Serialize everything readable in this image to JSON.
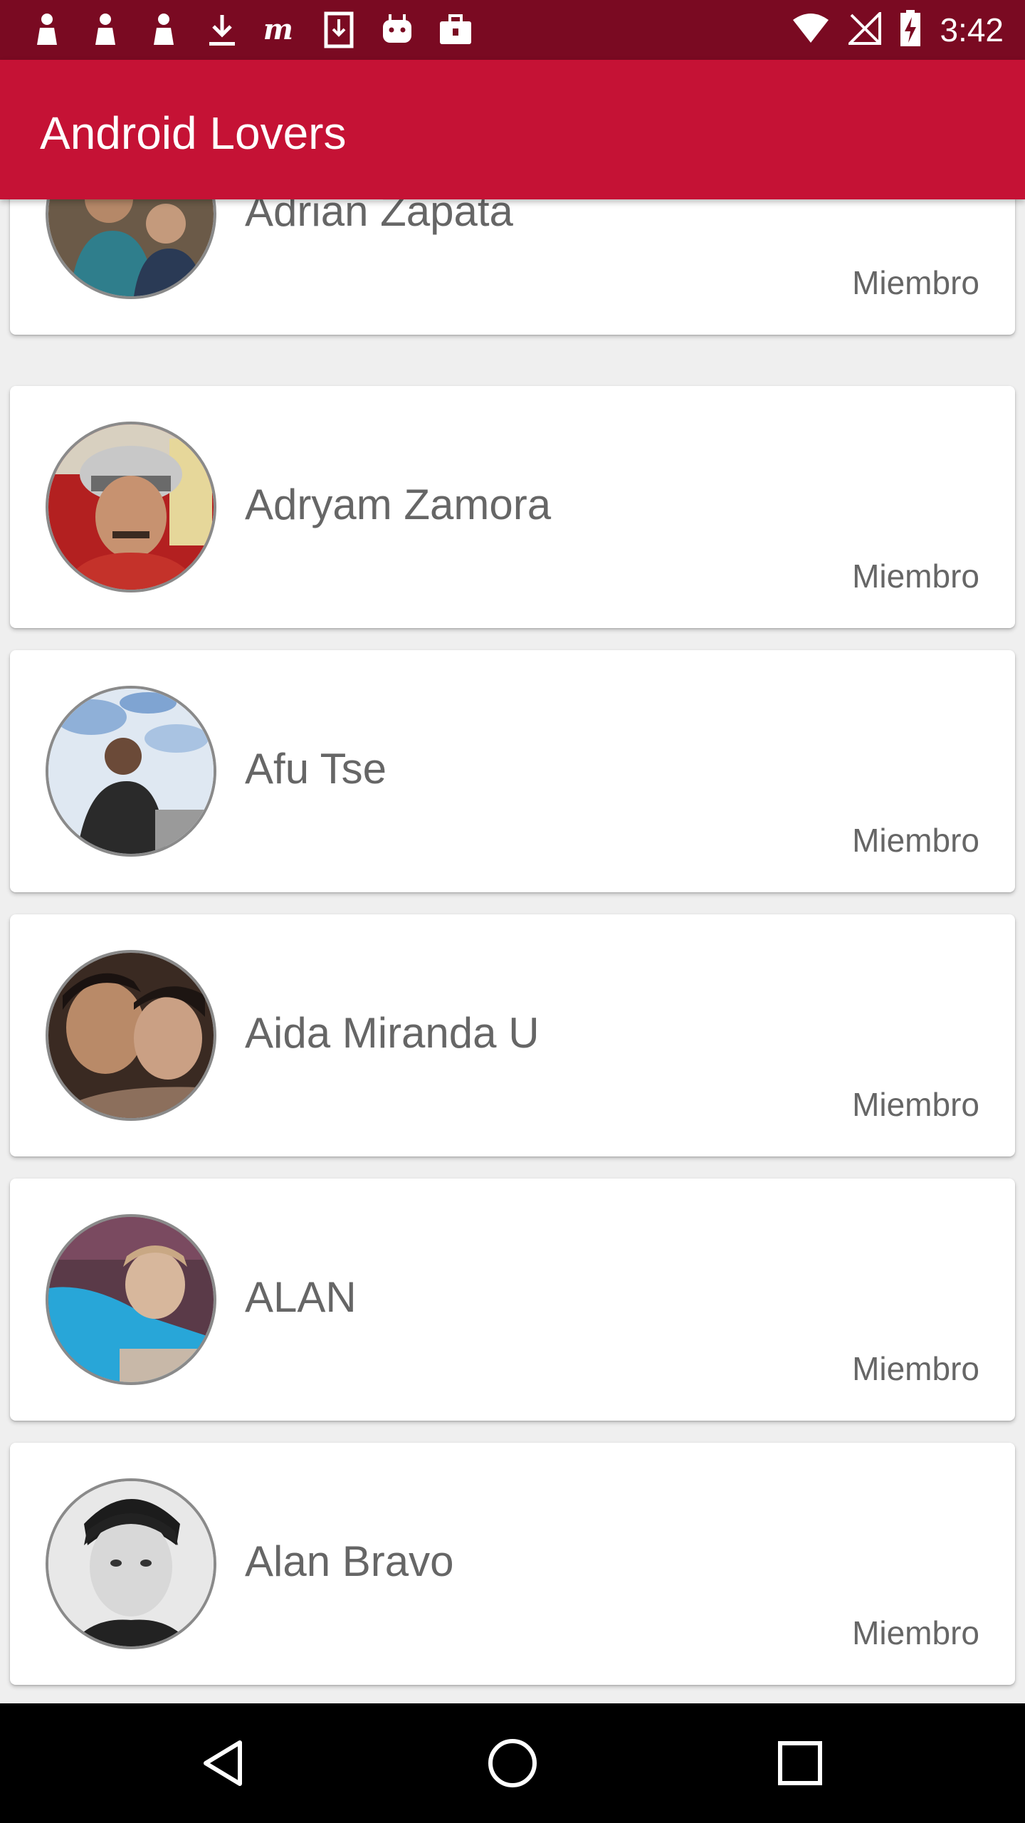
{
  "status_bar": {
    "time": "3:42",
    "left_icons": [
      "notification-pin-icon",
      "notification-pin-icon",
      "notification-pin-icon",
      "download-icon",
      "m-app-icon",
      "download-box-icon",
      "android-icon",
      "briefcase-icon"
    ],
    "right_icons": [
      "wifi-icon",
      "no-signal-icon",
      "battery-charging-icon"
    ]
  },
  "app_bar": {
    "title": "Android Lovers",
    "color": "#c51235"
  },
  "members": [
    {
      "name": "Adrian Zapata",
      "role": "Miembro"
    },
    {
      "name": "Adryam Zamora",
      "role": "Miembro"
    },
    {
      "name": "Afu Tse",
      "role": "Miembro"
    },
    {
      "name": "Aida Miranda U",
      "role": "Miembro"
    },
    {
      "name": "ALAN",
      "role": "Miembro"
    },
    {
      "name": "Alan Bravo",
      "role": "Miembro"
    }
  ],
  "nav_bar": {
    "buttons": [
      "back-icon",
      "home-icon",
      "recents-icon"
    ]
  }
}
